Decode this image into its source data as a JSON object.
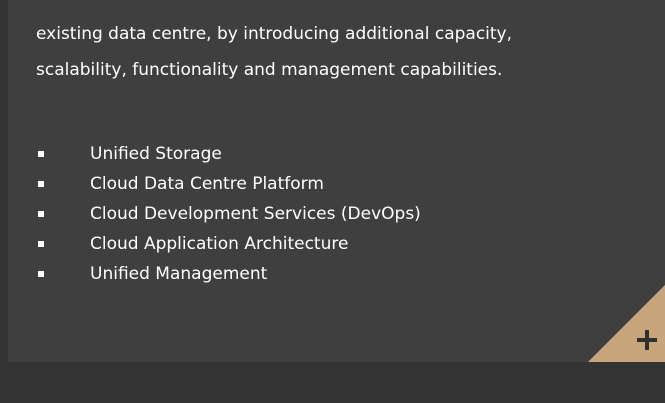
{
  "intro": {
    "line1": "existing data centre, by introducing additional capacity,",
    "line2": "scalability, functionality and management capabilities."
  },
  "features": [
    {
      "label": "Unified Storage"
    },
    {
      "label": "Cloud Data Centre Platform"
    },
    {
      "label": "Cloud Development Services (DevOps)"
    },
    {
      "label": "Cloud Application Architecture"
    },
    {
      "label": "Unified Management"
    }
  ],
  "expand_button": {
    "icon": "plus-icon",
    "color": "#c9a57b"
  },
  "colors": {
    "page_background": "#333333",
    "card_background": "#3f3f3f",
    "text": "#ffffff",
    "accent": "#c9a57b"
  }
}
